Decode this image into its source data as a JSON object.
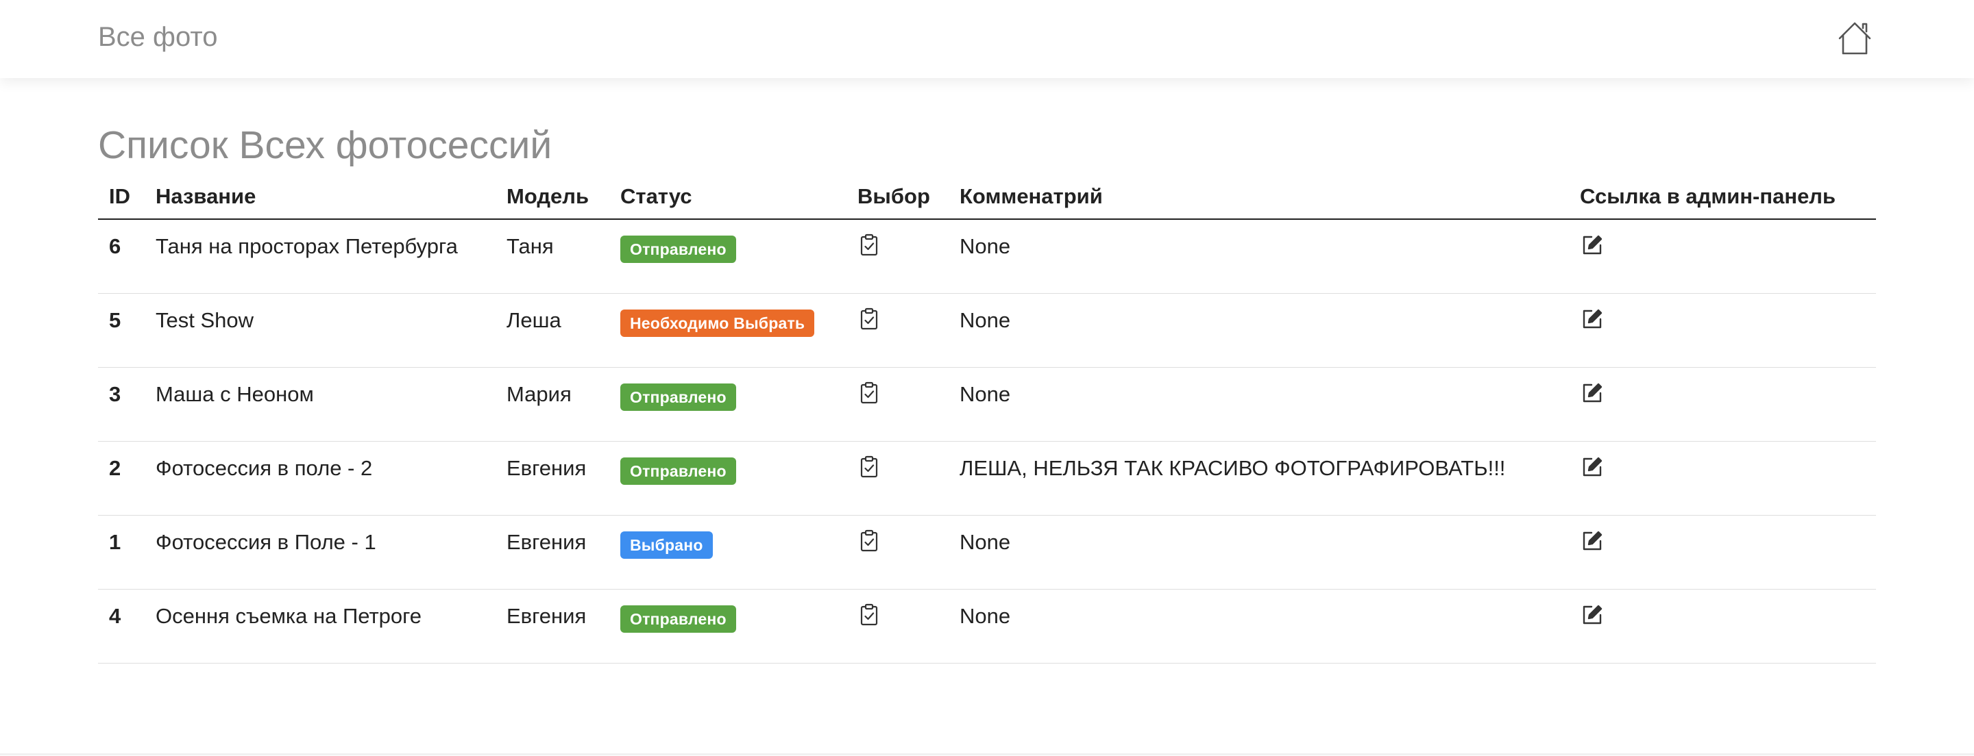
{
  "navbar": {
    "brand": "Все фото",
    "home_icon": "home-icon"
  },
  "page": {
    "title": "Список Всех фотосессий"
  },
  "table": {
    "columns": [
      "ID",
      "Название",
      "Модель",
      "Статус",
      "Выбор",
      "Комменатрий",
      "Ссылка в админ-панель"
    ],
    "rows": [
      {
        "id": "6",
        "name": "Таня на просторах Петербурга",
        "model": "Таня",
        "status": "Отправлено",
        "status_color": "#5aa543",
        "comment": "None"
      },
      {
        "id": "5",
        "name": "Test Show",
        "model": "Леша",
        "status": "Необходимо Выбрать",
        "status_color": "#ea6b28",
        "comment": "None"
      },
      {
        "id": "3",
        "name": "Маша с Неоном",
        "model": "Мария",
        "status": "Отправлено",
        "status_color": "#5aa543",
        "comment": "None"
      },
      {
        "id": "2",
        "name": "Фотосессия в поле - 2",
        "model": "Евгения",
        "status": "Отправлено",
        "status_color": "#5aa543",
        "comment": "ЛЕША, НЕЛЬЗЯ ТАК КРАСИВО ФОТОГРАФИРОВАТЬ!!!"
      },
      {
        "id": "1",
        "name": "Фотосессия в Поле - 1",
        "model": "Евгения",
        "status": "Выбрано",
        "status_color": "#3d8ef0",
        "comment": "None"
      },
      {
        "id": "4",
        "name": "Осення съемка на Петроге",
        "model": "Евгения",
        "status": "Отправлено",
        "status_color": "#5aa543",
        "comment": "None"
      }
    ],
    "select_icon": "clipboard-check-icon",
    "admin_icon": "edit-icon"
  },
  "colors": {
    "muted_text": "#8c8c8c",
    "body_text": "#222222",
    "status_sent": "#5aa543",
    "status_need_select": "#ea6b28",
    "status_selected": "#3d8ef0"
  }
}
